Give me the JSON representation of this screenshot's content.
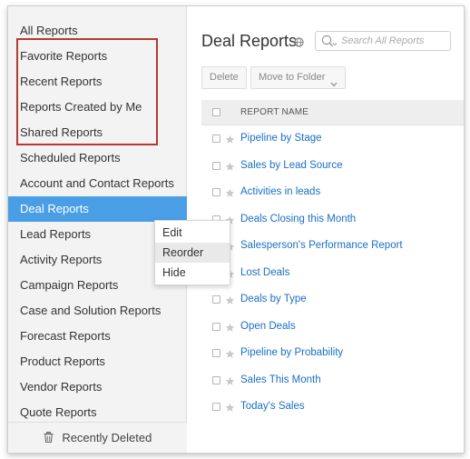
{
  "sidebar": {
    "items": [
      {
        "label": "All Reports"
      },
      {
        "label": "Favorite Reports"
      },
      {
        "label": "Recent Reports"
      },
      {
        "label": "Reports Created by Me"
      },
      {
        "label": "Shared Reports"
      },
      {
        "label": "Scheduled Reports"
      },
      {
        "label": "Account and Contact Reports"
      },
      {
        "label": "Deal Reports",
        "active": true
      },
      {
        "label": "Lead Reports"
      },
      {
        "label": "Activity Reports"
      },
      {
        "label": "Campaign Reports"
      },
      {
        "label": "Case and Solution Reports"
      },
      {
        "label": "Forecast Reports"
      },
      {
        "label": "Product Reports"
      },
      {
        "label": "Vendor Reports"
      },
      {
        "label": "Quote Reports"
      }
    ],
    "footer_label": "Recently Deleted",
    "active_color": "#4a9ee6",
    "highlight_color": "#b43a34"
  },
  "context_menu": {
    "items": [
      {
        "label": "Edit"
      },
      {
        "label": "Reorder",
        "hovered": true
      },
      {
        "label": "Hide"
      }
    ]
  },
  "main": {
    "title": "Deal Reports",
    "search_placeholder": "Search All Reports",
    "toolbar": {
      "delete_label": "Delete",
      "move_label": "Move to Folder"
    },
    "table": {
      "header": "REPORT NAME",
      "rows": [
        "Pipeline by Stage",
        "Sales by Lead Source",
        "Activities in leads",
        "Deals Closing this Month",
        "Salesperson's Performance Report",
        "Lost Deals",
        "Deals by Type",
        "Open Deals",
        "Pipeline by Probability",
        "Sales This Month",
        "Today's Sales"
      ]
    },
    "link_color": "#1a6fc4"
  }
}
